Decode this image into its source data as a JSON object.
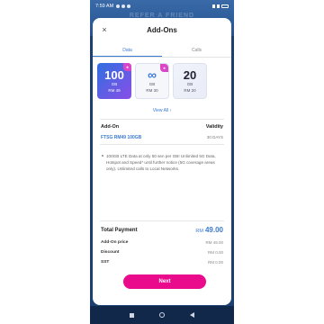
{
  "statusbar": {
    "time": "7:59 AM"
  },
  "background": {
    "banner": "REFER A FRIEND"
  },
  "sheet": {
    "close_icon": "×",
    "title": "Add-Ons",
    "tabs": [
      {
        "label": "Data",
        "active": true
      },
      {
        "label": "Calls",
        "active": false
      }
    ]
  },
  "plans": [
    {
      "big": "100",
      "unit": "GB",
      "price": "RM 49",
      "selected": true
    },
    {
      "big": "∞",
      "unit": "GB",
      "price": "RM 30",
      "selected": false
    },
    {
      "big": "20",
      "unit": "GB",
      "price": "RM 20",
      "selected": false
    }
  ],
  "view_all": "View All",
  "details": {
    "addon_header": "Add-On",
    "validity_header": "Validity",
    "plan_name": "FTSG RM49 100GB",
    "validity": "30 DAYS",
    "description": "100GB LTE Data at only 50 sen per GB! Unlimited 5G Data, Hotspot and Speed* until further notice (5G coverage areas only). Unlimited calls to Local Networks."
  },
  "payment": {
    "total_label": "Total Payment",
    "currency": "RM",
    "total_value": "49.00",
    "rows": [
      {
        "label": "Add-On price",
        "value": "RM 49.00"
      },
      {
        "label": "Discount",
        "value": "RM 0.00"
      },
      {
        "label": "SST",
        "value": "RM 0.00"
      }
    ]
  },
  "next_button": "Next",
  "colors": {
    "accent": "#3a7bd5",
    "cta": "#ea0a8c",
    "selected_gradient_start": "#2f6fe0",
    "selected_gradient_end": "#8a4ee8"
  }
}
